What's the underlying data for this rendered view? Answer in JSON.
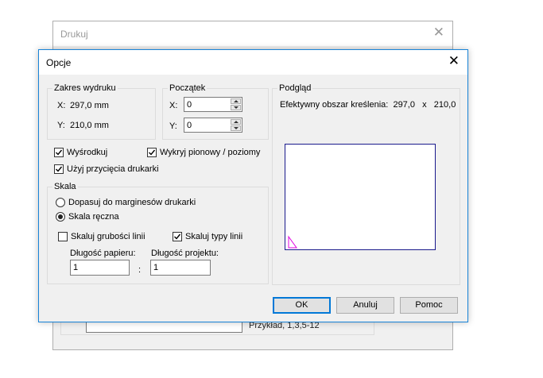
{
  "background_dialog": {
    "title": "Drukuj",
    "example_text": "Przykład, 1,3,5-12"
  },
  "dialog": {
    "title": "Opcje",
    "close_symbol": "✕"
  },
  "zakres": {
    "legend": "Zakres wydruku",
    "x_label": "X:",
    "x_value": "297,0 mm",
    "y_label": "Y:",
    "y_value": "210,0 mm"
  },
  "poczatek": {
    "legend": "Początek",
    "x_label": "X:",
    "x_value": "0",
    "y_label": "Y:",
    "y_value": "0"
  },
  "options": {
    "center_label": "Wyśrodkuj",
    "center_checked": true,
    "detect_label": "Wykryj pionowy / poziomy",
    "detect_checked": true,
    "clip_label": "Użyj przycięcia drukarki",
    "clip_checked": true
  },
  "skala": {
    "legend": "Skala",
    "fit_label": "Dopasuj do marginesów drukarki",
    "fit_selected": false,
    "manual_label": "Skala ręczna",
    "manual_selected": true,
    "scale_width_label": "Skaluj grubości linii",
    "scale_width_checked": false,
    "scale_types_label": "Skaluj typy linii",
    "scale_types_checked": true,
    "paper_length_label": "Długość papieru:",
    "paper_length_value": "1",
    "separator": ":",
    "project_length_label": "Długość projektu:",
    "project_length_value": "1"
  },
  "podglad": {
    "legend": "Podgląd",
    "area_text": "Efektywny obszar kreślenia:  297,0   x   210,0",
    "frame_color": "#1a1a8c",
    "origin_marker_color": "#e000e0"
  },
  "buttons": {
    "ok": "OK",
    "cancel": "Anuluj",
    "help": "Pomoc",
    "accent": "#0078d7"
  }
}
